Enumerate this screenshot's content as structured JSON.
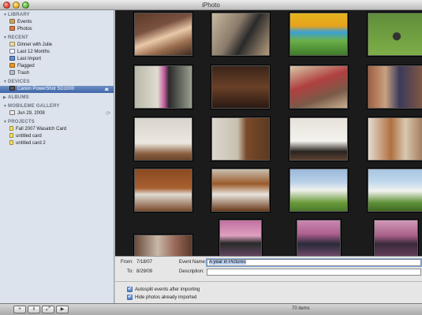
{
  "window": {
    "title": "iPhoto"
  },
  "sidebar": {
    "library": {
      "header": "LIBRARY",
      "items": [
        {
          "label": "Events",
          "icon": "events-icon"
        },
        {
          "label": "Photos",
          "icon": "photos-icon"
        }
      ]
    },
    "recent": {
      "header": "RECENT",
      "items": [
        {
          "label": "Dinner with Julie",
          "icon": "album-icon"
        },
        {
          "label": "Last 12 Months",
          "icon": "calendar-icon"
        },
        {
          "label": "Last Import",
          "icon": "import-icon"
        },
        {
          "label": "Flagged",
          "icon": "flag-icon"
        },
        {
          "label": "Trash",
          "icon": "trash-icon"
        }
      ]
    },
    "devices": {
      "header": "DEVICES",
      "items": [
        {
          "label": "Canon PowerShot SD1000",
          "icon": "camera-icon",
          "selected": true
        }
      ]
    },
    "albums": {
      "header": "ALBUMS"
    },
    "mobileme": {
      "header": "MOBILEME GALLERY",
      "items": [
        {
          "label": "Jun 29, 2008",
          "icon": "gallery-icon"
        }
      ]
    },
    "projects": {
      "header": "PROJECTS",
      "items": [
        {
          "label": "Fall 2007 Wasatch Card",
          "icon": "card-icon"
        },
        {
          "label": "untitled card",
          "icon": "card-icon"
        },
        {
          "label": "untitled card 2",
          "icon": "card-icon"
        }
      ]
    }
  },
  "import_panel": {
    "from_label": "From:",
    "from_value": "7/18/07",
    "to_label": "To:",
    "to_value": "8/29/09",
    "event_name_label": "Event Name:",
    "event_name_value": "A year in Pictures",
    "description_label": "Description:",
    "description_value": "",
    "autosplit_label": "Autosplit events after importing",
    "autosplit_checked": true,
    "hide_label": "Hide photos already imported",
    "hide_checked": true
  },
  "toolbar": {
    "add_glyph": "+",
    "info_glyph": "i",
    "slideshow_glyph": "⤢",
    "play_glyph": "▶",
    "item_count": "70 items"
  },
  "colors": {
    "selection": "#3f66a8",
    "sidebar_bg": "#dce3ec",
    "photo_bg": "#1b1b1b"
  }
}
